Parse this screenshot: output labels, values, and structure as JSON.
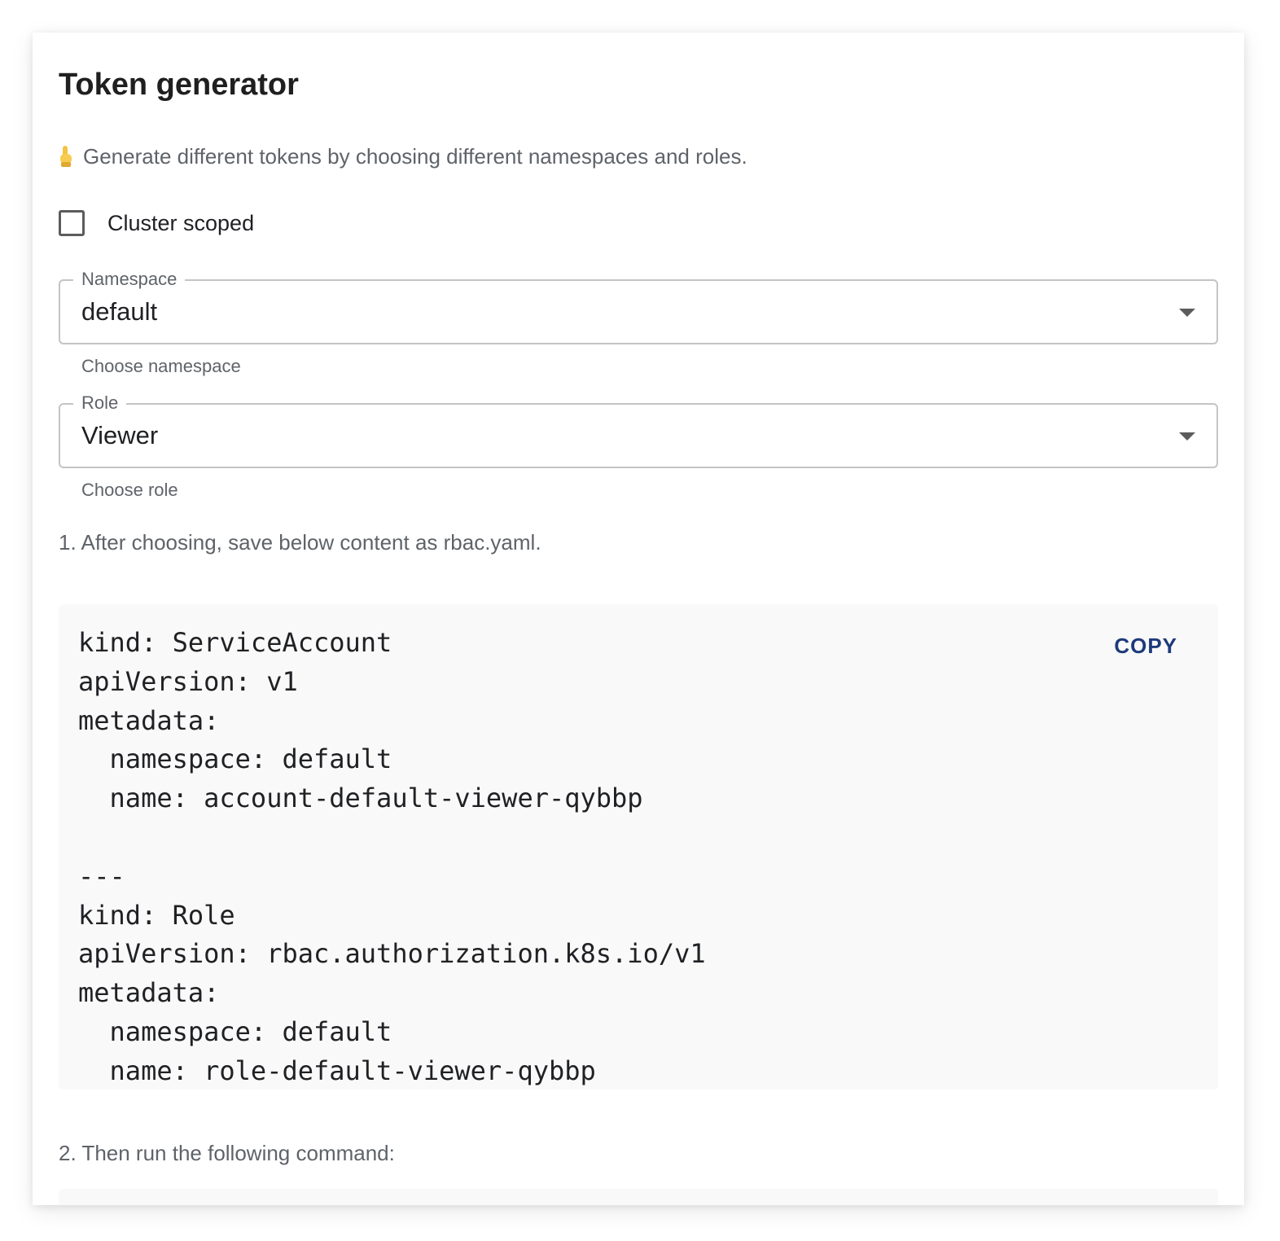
{
  "title": "Token generator",
  "intro": "Generate different tokens by choosing different namespaces and roles.",
  "icons": {
    "intro_icon": "pointing-down-hand-icon",
    "dropdown_icon": "caret-down-icon"
  },
  "cluster_scoped": {
    "label": "Cluster scoped",
    "checked": false
  },
  "namespace": {
    "label": "Namespace",
    "value": "default",
    "helper": "Choose namespace"
  },
  "role": {
    "label": "Role",
    "value": "Viewer",
    "helper": "Choose role"
  },
  "step1": "1. After choosing, save below content as rbac.yaml.",
  "yaml": {
    "copy_label": "COPY",
    "content": "kind: ServiceAccount\napiVersion: v1\nmetadata:\n  namespace: default\n  name: account-default-viewer-qybbp\n\n---\nkind: Role\napiVersion: rbac.authorization.k8s.io/v1\nmetadata:\n  namespace: default\n  name: role-default-viewer-qybbp"
  },
  "step2": "2. Then run the following command:",
  "colors": {
    "accent": "#1d3a7a",
    "code_bg": "#f9f9f9",
    "muted_text": "#5f6368"
  }
}
